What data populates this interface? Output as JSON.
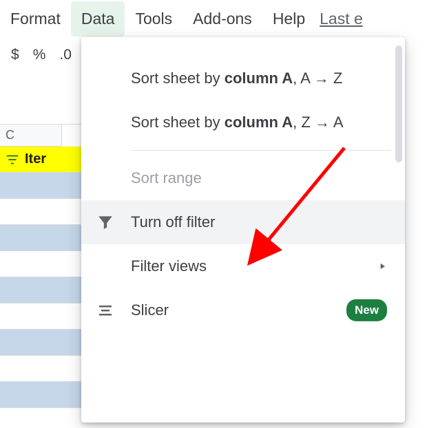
{
  "menubar": {
    "format": "Format",
    "data": "Data",
    "tools": "Tools",
    "addons": "Add-ons",
    "help": "Help",
    "lastedit": "Last e"
  },
  "toolbar": {
    "currency": "$",
    "percent": "%",
    "decimal": ".0"
  },
  "sheet": {
    "col": "C",
    "filtered_header": "Iter"
  },
  "dropdown": {
    "sort_asc_prefix": "Sort sheet by ",
    "sort_asc_col": "column A",
    "sort_asc_suffix": ", A → Z",
    "sort_desc_prefix": "Sort sheet by ",
    "sort_desc_col": "column A",
    "sort_desc_suffix": ", Z → A",
    "sort_range": "Sort range",
    "turn_off_filter": "Turn off filter",
    "filter_views": "Filter views",
    "slicer": "Slicer",
    "new_badge": "New"
  }
}
